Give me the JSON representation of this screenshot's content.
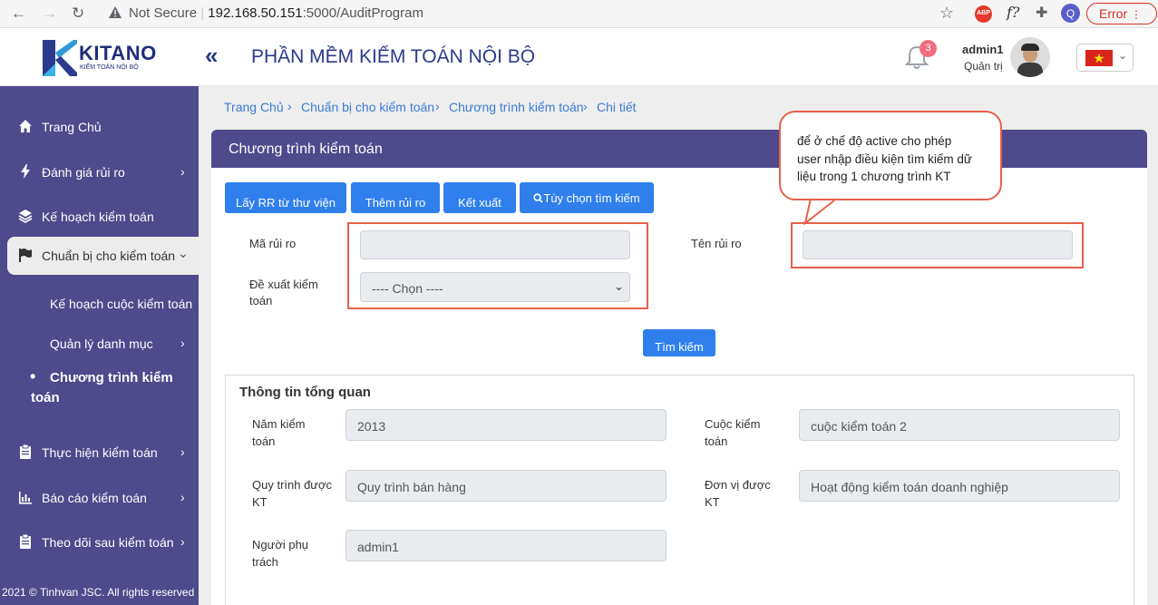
{
  "browser": {
    "not_secure": "Not Secure",
    "url_host": "192.168.50.151",
    "url_path": ":5000/AuditProgram",
    "error_label": "Error",
    "profile_initial": "Q"
  },
  "header": {
    "logo_name": "KITANO",
    "logo_tagline": "KIỂM TOÁN NỘI BỘ",
    "app_title": "PHẦN MỀM KIỂM TOÁN NỘI BỘ",
    "notification_count": "3",
    "user_name": "admin1",
    "user_role": "Quản trị"
  },
  "sidebar": {
    "items": [
      {
        "label": "Trang Chủ",
        "icon": "home-icon"
      },
      {
        "label": "Đánh giá rủi ro",
        "icon": "bolt-icon"
      },
      {
        "label": "Kế hoạch kiểm toán",
        "icon": "layers-icon"
      },
      {
        "label": "Chuẩn bị cho kiểm toán",
        "icon": "flag-icon"
      },
      {
        "label": "Kế hoạch cuộc kiểm toán"
      },
      {
        "label": "Quản lý danh mục"
      },
      {
        "label_line1": "Chương trình kiểm",
        "label_line2": "toán"
      },
      {
        "label": "Thực hiện kiểm toán",
        "icon": "clipboard-icon"
      },
      {
        "label": "Báo cáo kiểm toán",
        "icon": "bar-chart-icon"
      },
      {
        "label": "Theo dõi sau kiểm toán",
        "icon": "clipboard-icon"
      }
    ],
    "footer": "2021 © Tinhvan JSC. All rights reserved"
  },
  "breadcrumb": [
    "Trang Chủ",
    "Chuẩn bị cho kiểm toán",
    "Chương trình kiểm toán",
    "Chi tiết"
  ],
  "card": {
    "title": "Chương trình kiểm toán",
    "buttons": {
      "library": "Lấy RR từ thư viện",
      "add_risk": "Thêm rủi ro",
      "export": "Kết xuất",
      "search_options": "Tùy chọn tìm kiếm"
    },
    "filters": {
      "risk_code_label": "Mã rủi ro",
      "risk_code_value": "",
      "risk_name_label": "Tên rủi ro",
      "risk_name_value": "",
      "proposal_label_line1": "Đề xuất kiểm",
      "proposal_label_line2": "toán",
      "proposal_selected": "---- Chọn ----",
      "search_button": "Tìm kiếm"
    }
  },
  "callout": {
    "line1": "để ở chế độ active cho phép",
    "line2": "user nhập điều kiện tìm kiếm dữ",
    "line3": "liệu trong 1 chương trình KT"
  },
  "overview": {
    "title": "Thông tin tổng quan",
    "year_label_1": "Năm kiểm",
    "year_label_2": "toán",
    "year_value": "2013",
    "audit_label_1": "Cuộc kiểm",
    "audit_label_2": "toán",
    "audit_value": "cuộc kiểm toán 2",
    "process_label_1": "Quy trình được",
    "process_label_2": "KT",
    "process_value": "Quy trình bán hàng",
    "unit_label_1": "Đơn vị được",
    "unit_label_2": "KT",
    "unit_value": "Hoạt động kiểm toán doanh nghiệp",
    "owner_label_1": "Người phụ",
    "owner_label_2": "trách",
    "owner_value": "admin1"
  },
  "colors": {
    "sidebar": "#4e4a8c",
    "accent": "#2f80ed",
    "highlight": "#e8604c",
    "link": "#3a7bd5"
  }
}
